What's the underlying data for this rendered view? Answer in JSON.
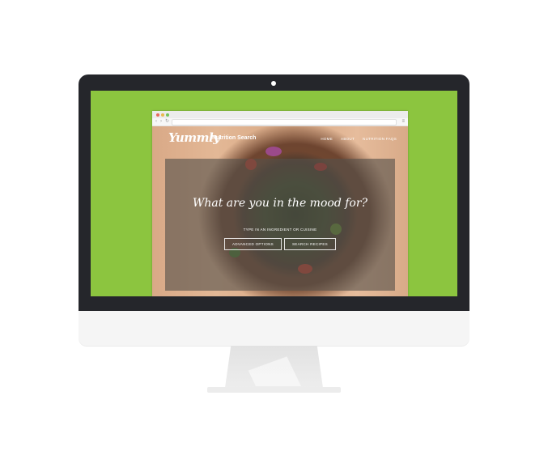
{
  "colors": {
    "accent": "#8cc53f"
  },
  "browser": {
    "controls": {
      "close": "close-dot",
      "minimize": "minimize-dot",
      "maximize": "maximize-dot"
    },
    "nav": {
      "back": "‹",
      "forward": "›",
      "reload": "↻",
      "menu": "≡"
    }
  },
  "site": {
    "logo": "Yummly",
    "title": "Nutrition Search",
    "nav": [
      "HOME",
      "ABOUT",
      "NUTRITION FAQS"
    ]
  },
  "hero": {
    "heading": "What are you in the mood for?",
    "prompt": "TYPE IN AN INGREDIENT OR CUISINE",
    "buttons": [
      "ADVANCED OPTIONS",
      "SEARCH RECIPES"
    ]
  }
}
